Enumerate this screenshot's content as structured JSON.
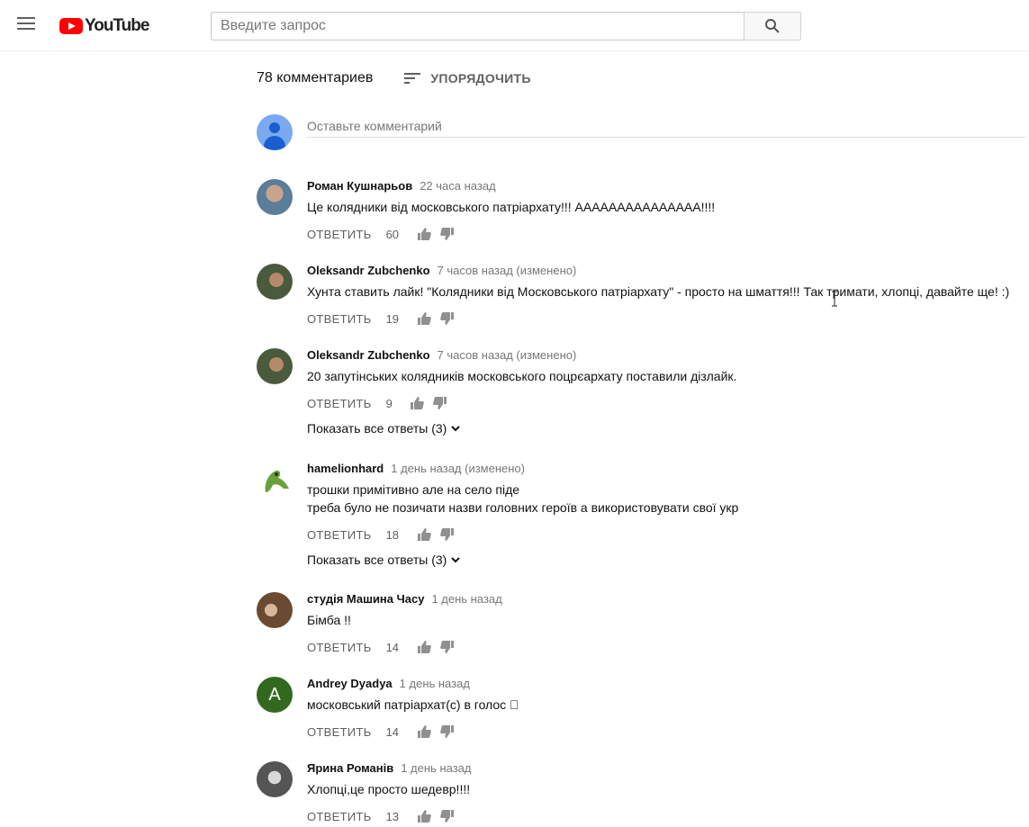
{
  "header": {
    "logo_text": "YouTube",
    "search_placeholder": "Введите запрос"
  },
  "comments_section": {
    "count_label": "78 комментариев",
    "sort_label": "УПОРЯДОЧИТЬ",
    "add_placeholder": "Оставьте комментарий",
    "reply_label": "ОТВЕТИТЬ",
    "items": [
      {
        "author": "Роман Кушнарьов",
        "time": "22 часа назад",
        "text": "Це колядники від московського патріархату!!! ААААААААААААААА!!!!",
        "likes": "60",
        "avatar_color": "#5a7d9a"
      },
      {
        "author": "Oleksandr Zubchenko",
        "time": "7 часов назад (изменено)",
        "text": "Хунта ставить лайк! \"Колядники від Московського патріархату\" - просто на шмаття!!! Так тримати, хлопці, давайте ще! :)",
        "likes": "19",
        "avatar_color": "#4a5a3c"
      },
      {
        "author": "Oleksandr Zubchenko",
        "time": "7 часов назад (изменено)",
        "text": "20 запутінських колядників московського поцрєархату поставили дізлайк.",
        "likes": "9",
        "avatar_color": "#4a5a3c",
        "show_replies": "Показать все ответы (3)"
      },
      {
        "author": "hamelionhard",
        "time": "1 день назад (изменено)",
        "text_line1": "трошки примітивно але на село піде",
        "text_line2": "треба було не позичати назви головних героїв а використовувати свої укр",
        "likes": "18",
        "avatar_color": "#6aa03a",
        "show_replies": "Показать все ответы (3)"
      },
      {
        "author": "студія Машина Часу",
        "time": "1 день назад",
        "text": "Бімба !!",
        "likes": "14",
        "avatar_color": "#6b4a32"
      },
      {
        "author": "Andrey Dyadya",
        "time": "1 день назад",
        "text": "московський патріархат(с) в голос 󾌴",
        "likes": "14",
        "avatar_letter": "A",
        "avatar_color": "#33691e"
      },
      {
        "author": "Ярина Романів",
        "time": "1 день назад",
        "text": "Хлопці,це просто шедевр!!!!",
        "likes": "13",
        "avatar_color": "#555555"
      }
    ]
  }
}
